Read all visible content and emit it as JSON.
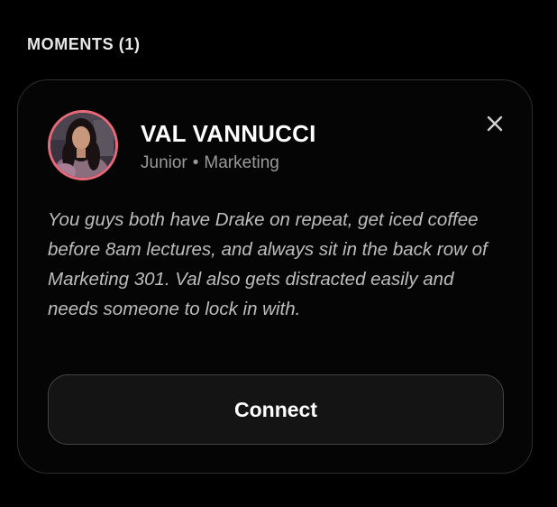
{
  "section": {
    "title": "MOMENTS (1)"
  },
  "card": {
    "name": "VAL VANNUCCI",
    "year": "Junior",
    "separator": "•",
    "major": "Marketing",
    "description": "You guys both have Drake on repeat, get iced coffee before 8am lectures, and always sit in the back row of Marketing 301. Val also gets distracted easily and needs someone to lock in with.",
    "connect_label": "Connect",
    "close_icon": "close-icon",
    "avatar_ring_color": "#e8697a"
  }
}
